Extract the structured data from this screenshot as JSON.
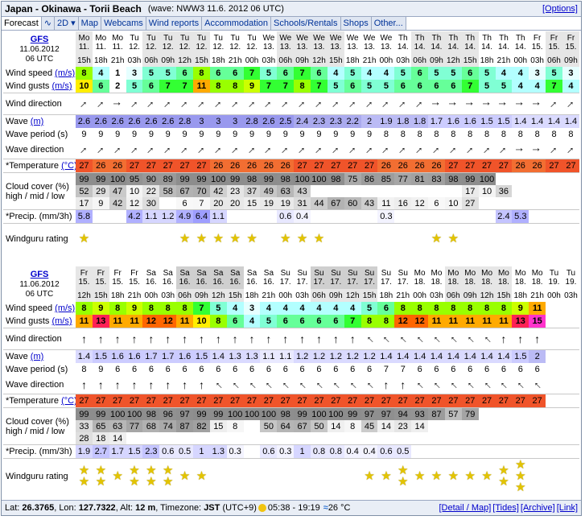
{
  "title": {
    "location": "Japan - Okinawa - Torii Beach",
    "wave_info": "(wave: NWW3 11.6. 2012 06 UTC)",
    "options": "[Options]"
  },
  "tabs": [
    "Forecast",
    "∿",
    "2D ▾",
    "Map",
    "Webcams",
    "Wind reports",
    "Accommodation",
    "Schools/Rentals",
    "Shops",
    "Other..."
  ],
  "labels": {
    "model": "GFS",
    "date": "11.06.2012",
    "run": "06 UTC",
    "wind_speed": "Wind speed",
    "wind_gusts": "Wind gusts",
    "unit_ms": "(m/s)",
    "wind_dir": "Wind direction",
    "wave": "Wave",
    "unit_m": "(m)",
    "wave_period": "Wave period (s)",
    "wave_dir": "Wave direction",
    "temp": "*Temperature",
    "unit_c": "(°C)",
    "cloud1": "Cloud cover (%)",
    "cloud2": "high / mid / low",
    "precip": "*Precip. (mm/3h)",
    "rating": "Windguru rating"
  },
  "blocks": [
    {
      "days": [
        "Mo",
        "Mo",
        "Mo",
        "Tu",
        "Tu",
        "Tu",
        "Tu",
        "Tu",
        "Tu",
        "Tu",
        "Tu",
        "We",
        "We",
        "We",
        "We",
        "We",
        "We",
        "We",
        "We",
        "Th",
        "Th",
        "Th",
        "Th",
        "Th",
        "Th",
        "Th",
        "Th",
        "Fr",
        "Fr",
        "Fr"
      ],
      "dates": [
        "11.",
        "11.",
        "11.",
        "12.",
        "12.",
        "12.",
        "12.",
        "12.",
        "12.",
        "12.",
        "12.",
        "13.",
        "13.",
        "13.",
        "13.",
        "13.",
        "13.",
        "13.",
        "13.",
        "14.",
        "14.",
        "14.",
        "14.",
        "14.",
        "14.",
        "14.",
        "14.",
        "15.",
        "15.",
        "15."
      ],
      "hours": [
        "15h",
        "18h",
        "21h",
        "03h",
        "06h",
        "09h",
        "12h",
        "15h",
        "18h",
        "21h",
        "00h",
        "03h",
        "06h",
        "09h",
        "12h",
        "15h",
        "18h",
        "21h",
        "00h",
        "03h",
        "06h",
        "09h",
        "12h",
        "15h",
        "18h",
        "21h",
        "00h",
        "03h",
        "06h",
        "09h"
      ],
      "wind_speed": [
        "8",
        "4",
        "1",
        "3",
        "5",
        "5",
        "6",
        "8",
        "6",
        "6",
        "7",
        "5",
        "6",
        "7",
        "6",
        "4",
        "5",
        "4",
        "4",
        "5",
        "6",
        "5",
        "5",
        "6",
        "5",
        "4",
        "4",
        "3",
        "5",
        "3"
      ],
      "wind_gusts": [
        "10",
        "6",
        "2",
        "5",
        "6",
        "7",
        "7",
        "11",
        "8",
        "8",
        "9",
        "7",
        "7",
        "8",
        "7",
        "5",
        "6",
        "5",
        "5",
        "6",
        "6",
        "6",
        "6",
        "7",
        "5",
        "5",
        "4",
        "4",
        "7",
        "4"
      ],
      "wind_dir": [
        225,
        225,
        270,
        225,
        225,
        225,
        225,
        225,
        225,
        225,
        225,
        225,
        225,
        225,
        225,
        225,
        225,
        225,
        225,
        225,
        225,
        270,
        270,
        270,
        270,
        270,
        270,
        270,
        225,
        225
      ],
      "wave": [
        "2.6",
        "2.6",
        "2.6",
        "2.6",
        "2.6",
        "2.6",
        "2.8",
        "3",
        "3",
        "3",
        "2.8",
        "2.6",
        "2.5",
        "2.4",
        "2.3",
        "2.3",
        "2.2",
        "2",
        "1.9",
        "1.8",
        "1.8",
        "1.7",
        "1.6",
        "1.6",
        "1.5",
        "1.5",
        "1.4",
        "1.4",
        "1.4",
        "1.4"
      ],
      "wave_period": [
        "9",
        "9",
        "9",
        "9",
        "9",
        "9",
        "9",
        "9",
        "9",
        "9",
        "9",
        "9",
        "9",
        "9",
        "9",
        "9",
        "9",
        "9",
        "8",
        "8",
        "8",
        "8",
        "8",
        "8",
        "8",
        "8",
        "8",
        "8",
        "8",
        "8"
      ],
      "wave_dir": [
        225,
        225,
        225,
        225,
        225,
        225,
        225,
        225,
        225,
        225,
        225,
        225,
        225,
        225,
        225,
        225,
        225,
        225,
        225,
        225,
        225,
        225,
        225,
        225,
        225,
        225,
        270,
        270,
        225,
        225
      ],
      "temp": [
        "27",
        "26",
        "26",
        "27",
        "27",
        "27",
        "27",
        "27",
        "26",
        "26",
        "26",
        "26",
        "26",
        "27",
        "27",
        "27",
        "27",
        "27",
        "26",
        "26",
        "26",
        "26",
        "27",
        "27",
        "27",
        "27",
        "26",
        "26",
        "27",
        "27"
      ],
      "cloud_h": [
        "99",
        "99",
        "100",
        "95",
        "90",
        "89",
        "99",
        "99",
        "100",
        "99",
        "98",
        "99",
        "98",
        "100",
        "100",
        "98",
        "75",
        "86",
        "85",
        "77",
        "81",
        "83",
        "98",
        "99",
        "100",
        "",
        "",
        "",
        "",
        ""
      ],
      "cloud_m": [
        "52",
        "29",
        "47",
        "10",
        "22",
        "58",
        "67",
        "70",
        "42",
        "23",
        "37",
        "49",
        "63",
        "43",
        "",
        "",
        "",
        "",
        "",
        "",
        "",
        "",
        "",
        "17",
        "10",
        "36",
        "",
        "",
        "",
        ""
      ],
      "cloud_l": [
        "17",
        "9",
        "42",
        "12",
        "30",
        "",
        "6",
        "7",
        "20",
        "20",
        "15",
        "19",
        "19",
        "31",
        "44",
        "67",
        "60",
        "43",
        "11",
        "16",
        "12",
        "6",
        "10",
        "27",
        "",
        "",
        "",
        "",
        "",
        ""
      ],
      "precip": [
        "5.8",
        "",
        "",
        "4.2",
        "1.1",
        "1.2",
        "4.9",
        "6.4",
        "1.1",
        "",
        "",
        "",
        "0.6",
        "0.4",
        "",
        "",
        "",
        "",
        "0.3",
        "",
        "",
        "",
        "",
        "",
        "",
        "2.4",
        "5.3",
        "",
        "",
        ""
      ],
      "rating": [
        1,
        0,
        0,
        0,
        0,
        0,
        1,
        1,
        1,
        1,
        1,
        0,
        1,
        1,
        1,
        0,
        0,
        0,
        0,
        0,
        0,
        1,
        1,
        0,
        0,
        0,
        0,
        0,
        0,
        0
      ]
    },
    {
      "days": [
        "Fr",
        "Fr",
        "Fr",
        "Fr",
        "Sa",
        "Sa",
        "Sa",
        "Sa",
        "Sa",
        "Sa",
        "Sa",
        "Sa",
        "Su",
        "Su",
        "Su",
        "Su",
        "Su",
        "Su",
        "Su",
        "Su",
        "Mo",
        "Mo",
        "Mo",
        "Mo",
        "Mo",
        "Mo",
        "Mo",
        "Mo",
        "Tu",
        "Tu"
      ],
      "dates": [
        "15.",
        "15.",
        "15.",
        "15.",
        "16.",
        "16.",
        "16.",
        "16.",
        "16.",
        "16.",
        "16.",
        "16.",
        "17.",
        "17.",
        "17.",
        "17.",
        "17.",
        "17.",
        "17.",
        "17.",
        "18.",
        "18.",
        "18.",
        "18.",
        "18.",
        "18.",
        "18.",
        "18.",
        "19.",
        "19."
      ],
      "hours": [
        "12h",
        "15h",
        "18h",
        "21h",
        "00h",
        "03h",
        "06h",
        "09h",
        "12h",
        "15h",
        "18h",
        "21h",
        "00h",
        "03h",
        "06h",
        "09h",
        "12h",
        "15h",
        "18h",
        "21h",
        "00h",
        "03h",
        "06h",
        "09h",
        "12h",
        "15h",
        "18h",
        "21h",
        "00h",
        "03h"
      ],
      "wind_speed": [
        "8",
        "9",
        "8",
        "9",
        "8",
        "8",
        "8",
        "7",
        "5",
        "4",
        "3",
        "4",
        "4",
        "4",
        "4",
        "4",
        "4",
        "5",
        "6",
        "8",
        "8",
        "8",
        "8",
        "8",
        "8",
        "8",
        "9",
        "11",
        "",
        ""
      ],
      "wind_gusts": [
        "11",
        "13",
        "11",
        "11",
        "12",
        "12",
        "11",
        "10",
        "8",
        "6",
        "4",
        "5",
        "6",
        "6",
        "6",
        "6",
        "7",
        "8",
        "8",
        "12",
        "12",
        "11",
        "11",
        "11",
        "11",
        "11",
        "13",
        "15",
        "",
        ""
      ],
      "wind_dir": [
        180,
        180,
        180,
        180,
        180,
        180,
        180,
        180,
        180,
        180,
        180,
        180,
        180,
        180,
        180,
        180,
        180,
        135,
        135,
        135,
        135,
        135,
        135,
        135,
        135,
        180,
        180,
        180,
        180,
        180
      ],
      "wave": [
        "1.4",
        "1.5",
        "1.6",
        "1.6",
        "1.7",
        "1.7",
        "1.6",
        "1.5",
        "1.4",
        "1.3",
        "1.3",
        "1.1",
        "1.1",
        "1.2",
        "1.2",
        "1.2",
        "1.2",
        "1.2",
        "1.4",
        "1.4",
        "1.4",
        "1.4",
        "1.4",
        "1.4",
        "1.4",
        "1.4",
        "1.5",
        "2",
        "",
        ""
      ],
      "wave_period": [
        "8",
        "9",
        "6",
        "6",
        "6",
        "6",
        "6",
        "6",
        "6",
        "6",
        "6",
        "6",
        "6",
        "6",
        "6",
        "6",
        "6",
        "6",
        "7",
        "7",
        "6",
        "6",
        "6",
        "6",
        "6",
        "6",
        "6",
        "6",
        "",
        ""
      ],
      "wave_dir": [
        180,
        180,
        180,
        180,
        180,
        180,
        180,
        180,
        135,
        135,
        135,
        135,
        135,
        135,
        135,
        135,
        135,
        135,
        180,
        180,
        135,
        135,
        135,
        135,
        135,
        135,
        135,
        135,
        180,
        180
      ],
      "temp": [
        "27",
        "27",
        "27",
        "27",
        "27",
        "27",
        "27",
        "27",
        "27",
        "27",
        "27",
        "27",
        "27",
        "27",
        "27",
        "27",
        "27",
        "27",
        "27",
        "27",
        "27",
        "27",
        "27",
        "27",
        "27",
        "27",
        "27",
        "27",
        "",
        ""
      ],
      "cloud_h": [
        "99",
        "99",
        "100",
        "100",
        "98",
        "96",
        "97",
        "99",
        "99",
        "100",
        "100",
        "100",
        "98",
        "99",
        "100",
        "100",
        "99",
        "97",
        "97",
        "94",
        "93",
        "87",
        "57",
        "79",
        "",
        "",
        "",
        "",
        "",
        ""
      ],
      "cloud_m": [
        "33",
        "65",
        "63",
        "77",
        "68",
        "74",
        "87",
        "82",
        "15",
        "8",
        "",
        "50",
        "64",
        "67",
        "50",
        "14",
        "8",
        "45",
        "14",
        "23",
        "14",
        "",
        "",
        "",
        "",
        "",
        "",
        "",
        "",
        ""
      ],
      "cloud_l": [
        "28",
        "18",
        "14",
        "",
        "",
        "",
        "",
        "",
        "",
        "",
        "",
        "",
        "",
        "",
        "",
        "",
        "",
        "",
        "",
        "",
        "",
        "",
        "",
        "",
        "",
        "",
        "",
        "",
        "",
        ""
      ],
      "precip": [
        "1.9",
        "2.7",
        "1.7",
        "1.5",
        "2.3",
        "0.6",
        "0.5",
        "1",
        "1.3",
        "0.3",
        "",
        "0.6",
        "0.3",
        "1",
        "0.8",
        "0.8",
        "0.4",
        "0.4",
        "0.6",
        "0.5",
        "",
        "",
        "",
        "",
        "",
        "",
        "",
        "",
        "",
        ""
      ],
      "rating": [
        2,
        2,
        1,
        2,
        2,
        2,
        1,
        1,
        0,
        0,
        0,
        0,
        0,
        0,
        0,
        0,
        0,
        1,
        1,
        2,
        1,
        1,
        1,
        1,
        1,
        2,
        3,
        0,
        0,
        0
      ]
    }
  ],
  "footer": {
    "lat_label": "Lat:",
    "lat": "26.3765",
    "lon_label": "Lon:",
    "lon": "127.7322",
    "alt_label": "Alt:",
    "alt": "12 m",
    "tz_label": "Timezone:",
    "tz": "JST",
    "tz_off": "(UTC+9)",
    "sun": "05:38 - 19:19",
    "water": "26 °C",
    "links": [
      "[Detail / Map]",
      "[Tides]",
      "[Archive]",
      "[Link]"
    ]
  },
  "colors": {
    "accent": "#0000cc"
  }
}
